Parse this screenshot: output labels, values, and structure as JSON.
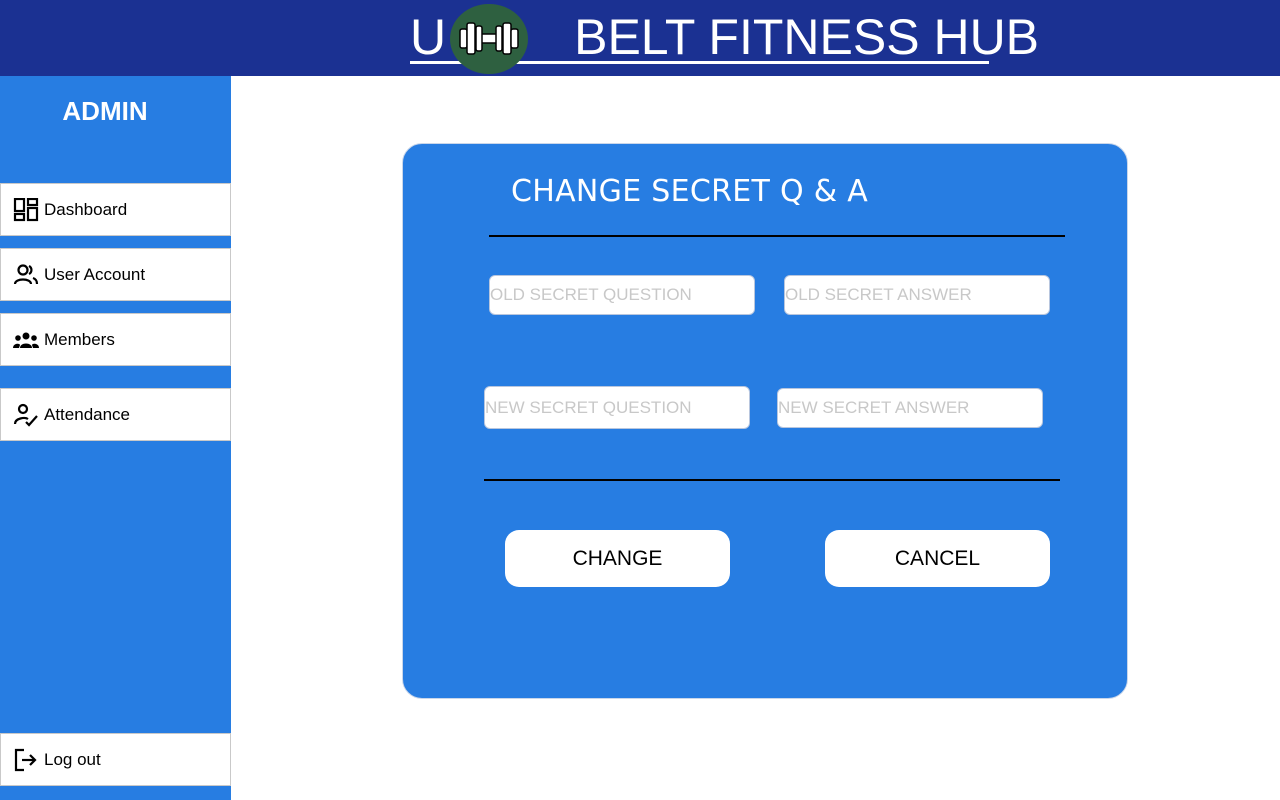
{
  "header": {
    "title_left": "U",
    "title_right": "BELT FITNESS HUB",
    "logo_icon": "dumbbell-icon",
    "background": "#1b3192",
    "logo_color": "#2e6040"
  },
  "sidebar": {
    "role": "ADMIN",
    "background": "#277de2",
    "items": [
      {
        "label": "Dashboard",
        "icon": "dashboard-icon"
      },
      {
        "label": "User Account",
        "icon": "user-account-icon"
      },
      {
        "label": "Members",
        "icon": "members-icon"
      },
      {
        "label": "Attendance",
        "icon": "attendance-icon"
      }
    ],
    "logout": {
      "label": "Log out",
      "icon": "logout-icon"
    }
  },
  "form": {
    "title": "CHANGE SECRET Q & A",
    "old_question": {
      "value": "",
      "placeholder": "OLD SECRET QUESTION"
    },
    "old_answer": {
      "value": "",
      "placeholder": "OLD SECRET ANSWER"
    },
    "new_question": {
      "value": "",
      "placeholder": "NEW SECRET QUESTION"
    },
    "new_answer": {
      "value": "",
      "placeholder": "NEW SECRET ANSWER"
    },
    "change_label": "CHANGE",
    "cancel_label": "CANCEL"
  }
}
